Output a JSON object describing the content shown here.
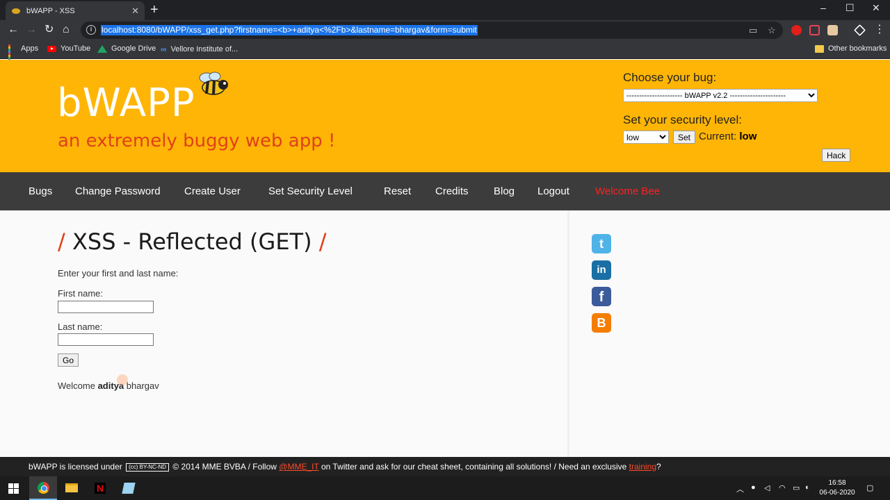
{
  "browser": {
    "tab_title": "bWAPP - XSS",
    "tab_close": "✕",
    "new_tab": "+",
    "url": "localhost:8080/bWAPP/xss_get.php?firstname=<b>+aditya<%2Fb>&lastname=bhargav&form=submit",
    "window_controls": {
      "minimize": "–",
      "maximize": "☐",
      "close": "✕"
    },
    "nav": {
      "back": "←",
      "forward": "→",
      "reload": "↻",
      "home": "⌂"
    },
    "bookmarks": [
      {
        "label": "Apps",
        "icon": "apps-grid-icon"
      },
      {
        "label": "YouTube",
        "icon": "youtube-icon"
      },
      {
        "label": "Google Drive",
        "icon": "google-drive-icon"
      },
      {
        "label": "Vellore Institute of...",
        "icon": "vit-icon"
      }
    ],
    "other_bookmarks": "Other bookmarks"
  },
  "header": {
    "logo": "bWAPP",
    "tagline": "an extremely buggy web app !",
    "choose_bug_label": "Choose your bug:",
    "bug_selected": "---------------------- bWAPP v2.2 ----------------------",
    "hack_button": "Hack",
    "security_label": "Set your security level:",
    "security_selected": "low",
    "set_button": "Set",
    "current_label": "Current:",
    "current_value": "low"
  },
  "nav": {
    "items": [
      "Bugs",
      "Change Password",
      "Create User",
      "Set Security Level",
      "Reset",
      "Credits",
      "Blog",
      "Logout"
    ],
    "welcome": "Welcome Bee"
  },
  "main": {
    "title": "XSS - Reflected (GET)",
    "title_slash": "/",
    "prompt": "Enter your first and last name:",
    "first_label": "First name:",
    "last_label": "Last name:",
    "first_value": "",
    "last_value": "",
    "go_button": "Go",
    "welcome_prefix": "Welcome",
    "welcome_bold": "aditya",
    "welcome_rest": "bhargav"
  },
  "social": [
    {
      "name": "twitter-icon",
      "glyph": "t"
    },
    {
      "name": "linkedin-icon",
      "glyph": "in"
    },
    {
      "name": "facebook-icon",
      "glyph": "f"
    },
    {
      "name": "blogger-icon",
      "glyph": "B"
    }
  ],
  "footer": {
    "part1": "bWAPP is licensed under",
    "cc_badge": "(cc) BY-NC-ND",
    "part2": "© 2014 MME BVBA / Follow",
    "twitter_link": "@MME_IT",
    "part3": "on Twitter and ask for our cheat sheet, containing all solutions! / Need an exclusive",
    "training_link": "training",
    "part4": "?"
  },
  "taskbar": {
    "time": "16:58",
    "date": "06-06-2020"
  },
  "colors": {
    "header_bg": "#ffb505",
    "tagline": "#e0401a",
    "nav_bg": "#3c3c3c",
    "welcome_nav": "#ff2020"
  }
}
